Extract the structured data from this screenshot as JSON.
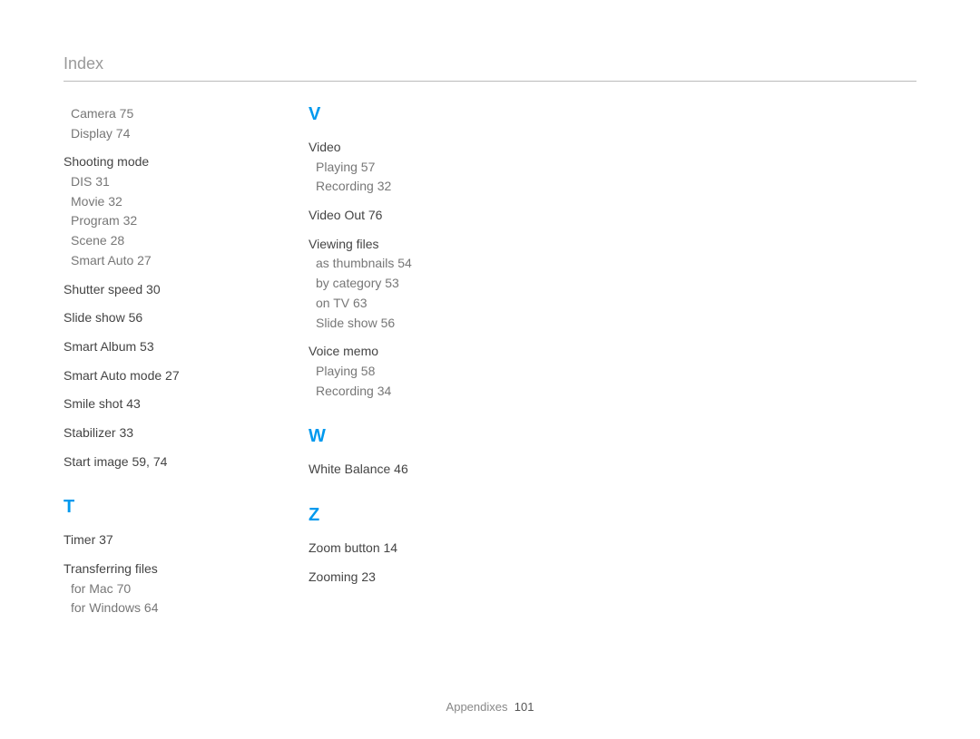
{
  "header": "Index",
  "col1": {
    "sub_camera": "Camera  75",
    "sub_display": "Display  74",
    "shooting_mode": "Shooting mode",
    "sm_dis": "DIS  31",
    "sm_movie": "Movie  32",
    "sm_program": "Program  32",
    "sm_scene": "Scene  28",
    "sm_smartauto": "Smart Auto  27",
    "shutter_speed": "Shutter speed  30",
    "slide_show": "Slide show  56",
    "smart_album": "Smart Album  53",
    "smart_auto_mode": "Smart Auto mode  27",
    "smile_shot": "Smile shot  43",
    "stabilizer": "Stabilizer  33",
    "start_image": "Start image  59, 74",
    "letter_t": "T",
    "timer": "Timer  37",
    "transferring_files": "Transferring files",
    "tf_mac": "for Mac  70",
    "tf_windows": "for Windows  64"
  },
  "col2": {
    "letter_v": "V",
    "video": "Video",
    "video_playing": "Playing  57",
    "video_recording": "Recording  32",
    "video_out": "Video Out  76",
    "viewing_files": "Viewing files",
    "vf_thumbnails": "as thumbnails  54",
    "vf_category": "by category  53",
    "vf_tv": "on TV  63",
    "vf_slideshow": "Slide show  56",
    "voice_memo": "Voice memo",
    "vm_playing": "Playing  58",
    "vm_recording": "Recording  34",
    "letter_w": "W",
    "white_balance": "White Balance  46",
    "letter_z": "Z",
    "zoom_button": "Zoom button  14",
    "zooming": "Zooming  23"
  },
  "footer": {
    "label": "Appendixes",
    "page": "101"
  }
}
